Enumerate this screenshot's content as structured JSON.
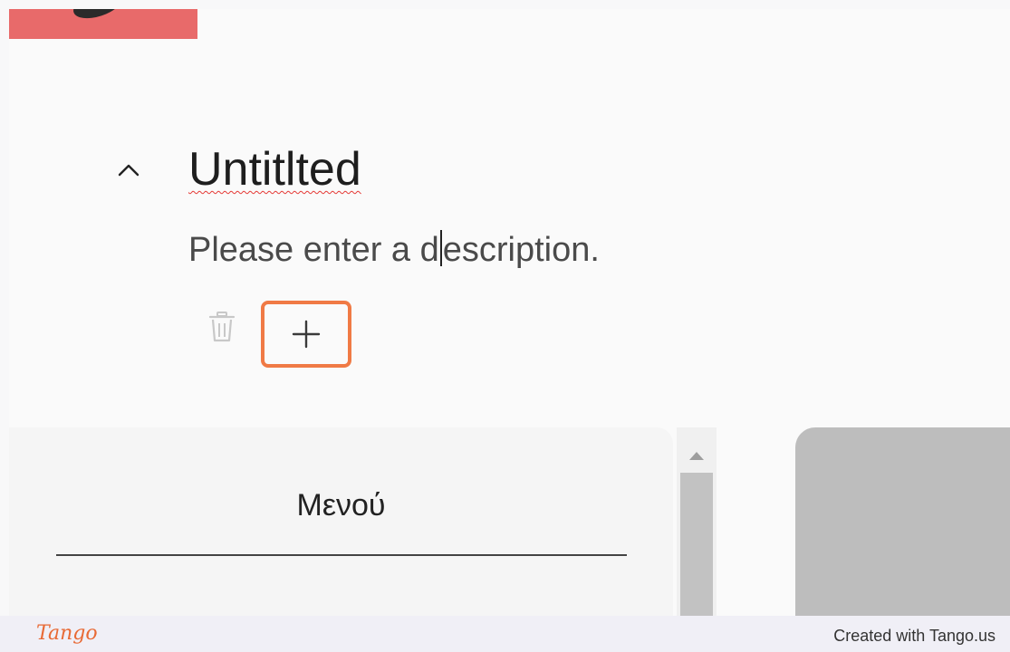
{
  "section": {
    "title": "Untitlted",
    "description_before_caret": "Please enter a d",
    "description_after_caret": "escription."
  },
  "toolbar": {
    "collapse_icon": "chevron-up-icon",
    "delete_icon": "trash-icon",
    "add_icon": "plus-icon"
  },
  "menu": {
    "label": "Μενού"
  },
  "footer": {
    "logo": "Tango",
    "credit": "Created with Tango.us"
  },
  "colors": {
    "highlight": "#f07a45",
    "banner": "#e86a6a",
    "spellcheck": "#e53935"
  }
}
